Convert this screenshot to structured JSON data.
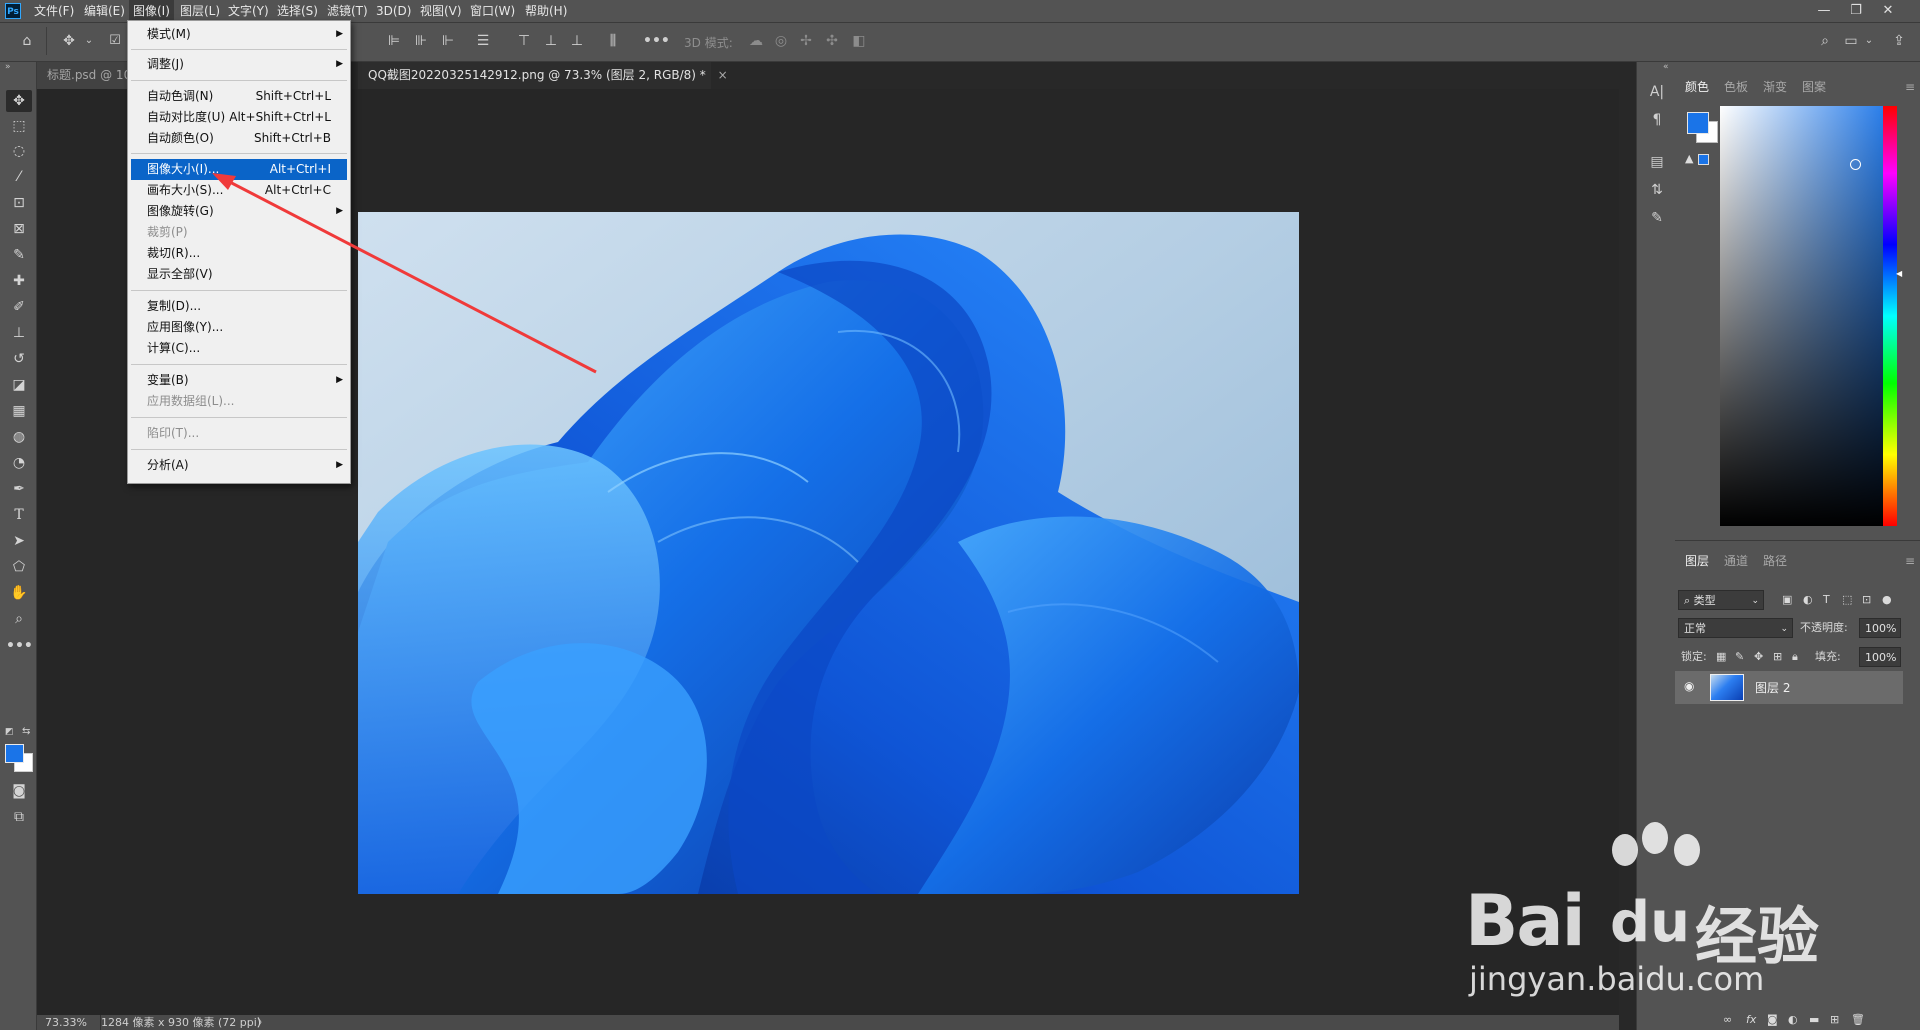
{
  "app": {
    "logo": "Ps"
  },
  "menubar": {
    "items": [
      "文件(F)",
      "编辑(E)",
      "图像(I)",
      "图层(L)",
      "文字(Y)",
      "选择(S)",
      "滤镜(T)",
      "3D(D)",
      "视图(V)",
      "窗口(W)",
      "帮助(H)"
    ],
    "active_index": 2
  },
  "window_controls": {
    "minimize": "—",
    "restore": "❐",
    "close": "✕"
  },
  "options_bar": {
    "mode_3d_label": "3D 模式:"
  },
  "tabs": [
    {
      "label": "标题.psd @ 10",
      "active": false
    },
    {
      "label": "QQ截图20220325142912.png @ 73.3% (图层 2, RGB/8) *",
      "active": true,
      "close": "×"
    }
  ],
  "status_bar": {
    "zoom": "73.33%",
    "doc_info": "1284 像素 x 930 像素 (72 ppi)",
    "arrow": "〉"
  },
  "image_menu": {
    "groups": [
      [
        {
          "label": "模式(M)",
          "submenu": true
        }
      ],
      [
        {
          "label": "调整(J)",
          "submenu": true
        }
      ],
      [
        {
          "label": "自动色调(N)",
          "shortcut": "Shift+Ctrl+L"
        },
        {
          "label": "自动对比度(U)",
          "shortcut": "Alt+Shift+Ctrl+L"
        },
        {
          "label": "自动颜色(O)",
          "shortcut": "Shift+Ctrl+B"
        }
      ],
      [
        {
          "label": "图像大小(I)...",
          "shortcut": "Alt+Ctrl+I",
          "highlighted": true
        },
        {
          "label": "画布大小(S)...",
          "shortcut": "Alt+Ctrl+C"
        },
        {
          "label": "图像旋转(G)",
          "submenu": true
        },
        {
          "label": "裁剪(P)",
          "disabled": true
        },
        {
          "label": "裁切(R)..."
        },
        {
          "label": "显示全部(V)"
        }
      ],
      [
        {
          "label": "复制(D)..."
        },
        {
          "label": "应用图像(Y)..."
        },
        {
          "label": "计算(C)..."
        }
      ],
      [
        {
          "label": "变量(B)",
          "submenu": true
        },
        {
          "label": "应用数据组(L)...",
          "disabled": true
        }
      ],
      [
        {
          "label": "陷印(T)...",
          "disabled": true
        }
      ],
      [
        {
          "label": "分析(A)",
          "submenu": true
        }
      ]
    ]
  },
  "color_panel": {
    "tabs": [
      "颜色",
      "色板",
      "渐变",
      "图案"
    ],
    "foreground": "#1a74e8",
    "background": "#ffffff"
  },
  "layers_panel": {
    "tabs": [
      "图层",
      "通道",
      "路径"
    ],
    "filter_label": "类型",
    "blend_mode": "正常",
    "opacity_label": "不透明度:",
    "opacity_value": "100%",
    "lock_label": "锁定:",
    "fill_label": "填充:",
    "fill_value": "100%",
    "layers": [
      {
        "name": "图层 2",
        "visible": true
      }
    ]
  },
  "watermark": {
    "brand_left": "Bai",
    "brand_mid": "du",
    "brand_cn": "经验",
    "url": "jingyan.baidu.com"
  }
}
